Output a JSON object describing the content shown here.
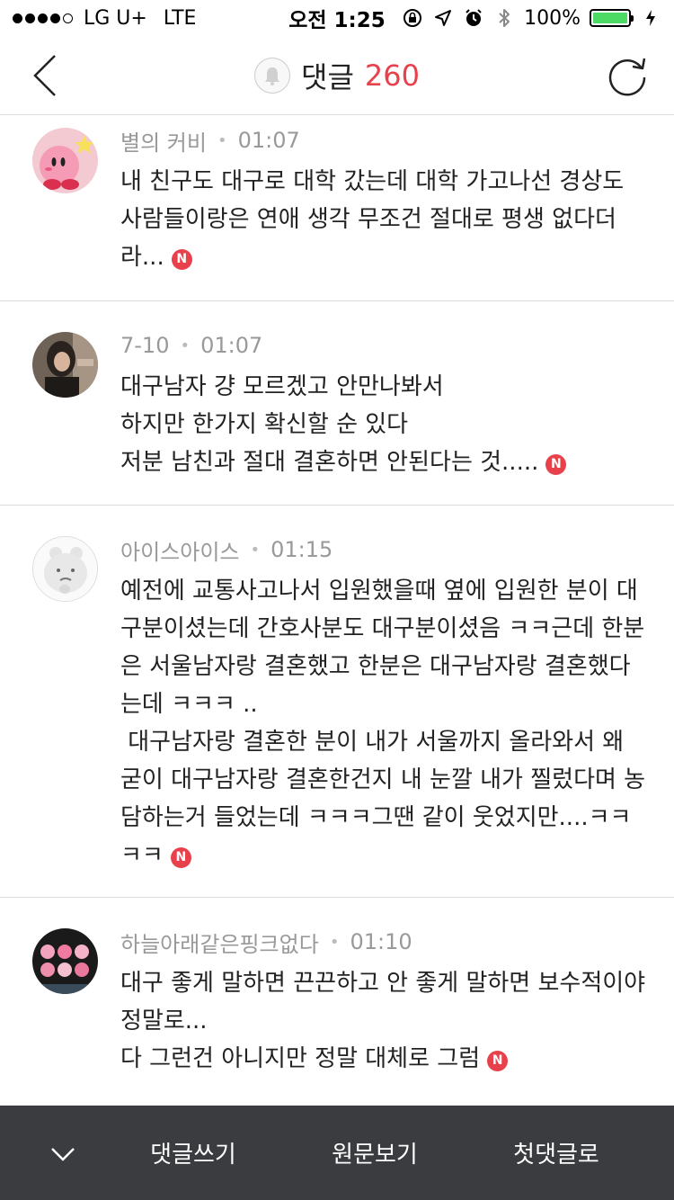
{
  "status_bar": {
    "carrier": "LG U+",
    "network": "LTE",
    "time": "오전 1:25",
    "battery": "100%"
  },
  "header": {
    "title": "댓글",
    "count": "260"
  },
  "comments": [
    {
      "author": "별의 커비",
      "time": "01:07",
      "text": "내 친구도 대구로 대학 갔는데 대학 가고나선 경상도 사람들이랑은 연애 생각 무조건 절대로 평생 없다더라...",
      "badge": "N"
    },
    {
      "author": "7-10",
      "time": "01:07",
      "text": "대구남자 걍 모르겠고 안만나봐서\n하지만 한가지 확신할 순 있다\n저분 남친과 절대 결혼하면 안된다는 것.....",
      "badge": "N"
    },
    {
      "author": "아이스아이스",
      "time": "01:15",
      "text": "예전에 교통사고나서 입원했을때 옆에 입원한 분이 대구분이셨는데 간호사분도 대구분이셨음 ㅋㅋ근데 한분은 서울남자랑 결혼했고 한분은 대구남자랑 결혼했다는데 ㅋㅋㅋ ..\n 대구남자랑 결혼한 분이 내가 서울까지 올라와서 왜 굳이 대구남자랑 결혼한건지 내 눈깔 내가 찔렀다며 농담하는거 들었는데 ㅋㅋㅋ그땐 같이 웃었지만....ㅋㅋㅋㅋ",
      "badge": "N"
    },
    {
      "author": "하늘아래같은핑크없다",
      "time": "01:10",
      "text": "대구 좋게 말하면 끈끈하고 안 좋게 말하면 보수적이야 정말로...\n다 그런건 아니지만 정말 대체로 그럼",
      "badge": "N"
    }
  ],
  "toolbar": {
    "write_label": "댓글쓰기",
    "original_label": "원문보기",
    "first_comment_label": "첫댓글로"
  },
  "colors": {
    "accent": "#e8414b",
    "toolbar_bg": "#3a3c40"
  }
}
